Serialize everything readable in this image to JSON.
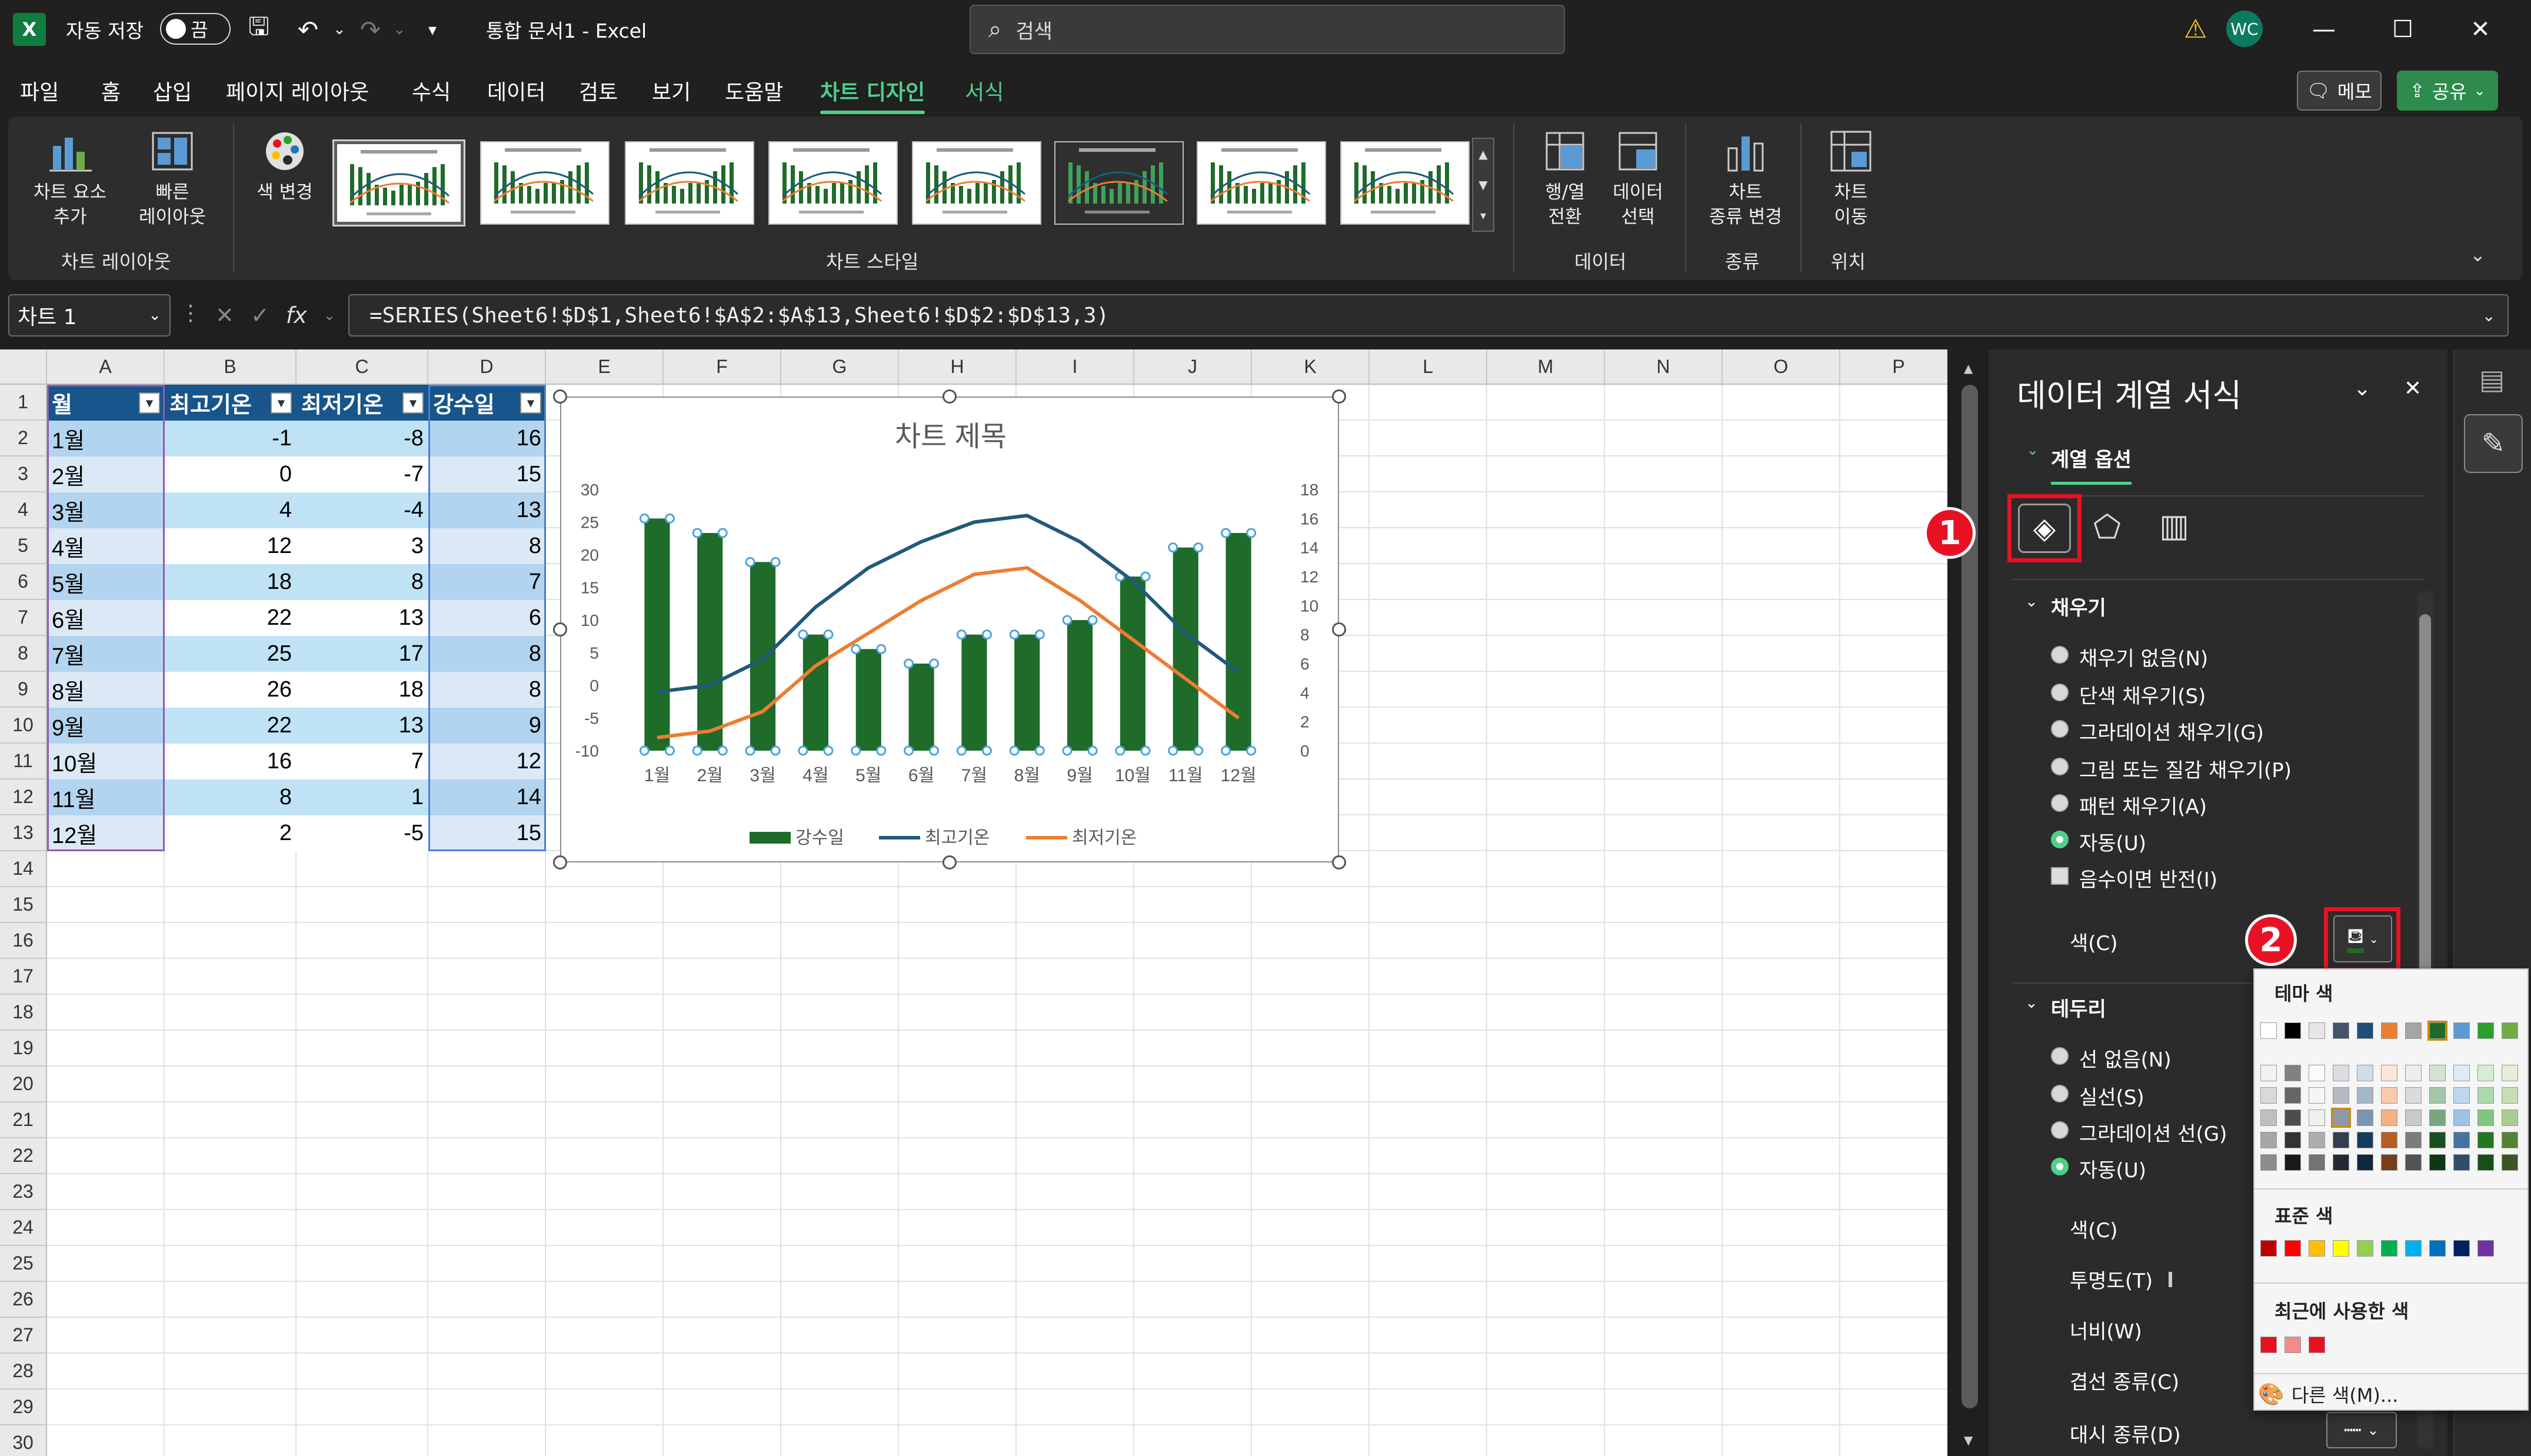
{
  "titlebar": {
    "autosave_label": "자동 저장",
    "autosave_state": "끔",
    "document_title": "통합 문서1  -  Excel",
    "search_placeholder": "검색",
    "user_initials": "WC",
    "app_logo": "X"
  },
  "ribbon_tabs": [
    "파일",
    "홈",
    "삽입",
    "페이지 레이아웃",
    "수식",
    "데이터",
    "검토",
    "보기",
    "도움말",
    "차트 디자인",
    "서식"
  ],
  "active_tab": "차트 디자인",
  "top_buttons": {
    "memo": "메모",
    "share": "공유"
  },
  "ribbon": {
    "add_element": [
      "차트 요소",
      "추가"
    ],
    "quick_layout": [
      "빠른",
      "레이아웃"
    ],
    "change_color": "색 변경",
    "switch_rowcol": [
      "행/열",
      "전환"
    ],
    "select_data": [
      "데이터",
      "선택"
    ],
    "change_type": [
      "차트",
      "종류 변경"
    ],
    "move_chart": [
      "차트",
      "이동"
    ],
    "groups": {
      "layout": "차트 레이아웃",
      "styles": "차트 스타일",
      "data": "데이터",
      "type": "종류",
      "location": "위치"
    }
  },
  "formula_bar": {
    "name_box": "차트 1",
    "fx": "fx",
    "formula": "=SERIES(Sheet6!$D$1,Sheet6!$A$2:$A$13,Sheet6!$D$2:$D$13,3)"
  },
  "grid": {
    "columns": [
      "A",
      "B",
      "C",
      "D",
      "E",
      "F",
      "G",
      "H",
      "I",
      "J",
      "K",
      "L",
      "M",
      "N",
      "O",
      "P"
    ],
    "rows": [
      "1",
      "2",
      "3",
      "4",
      "5",
      "6",
      "7",
      "8",
      "9",
      "10",
      "11",
      "12",
      "13",
      "14",
      "15",
      "16",
      "17",
      "18",
      "19",
      "20",
      "21",
      "22",
      "23",
      "24",
      "25",
      "26",
      "27",
      "28",
      "29",
      "30"
    ]
  },
  "table": {
    "headers": [
      "월",
      "최고기온",
      "최저기온",
      "강수일"
    ],
    "rows": [
      [
        "1월",
        "-1",
        "-8",
        "16"
      ],
      [
        "2월",
        "0",
        "-7",
        "15"
      ],
      [
        "3월",
        "4",
        "-4",
        "13"
      ],
      [
        "4월",
        "12",
        "3",
        "8"
      ],
      [
        "5월",
        "18",
        "8",
        "7"
      ],
      [
        "6월",
        "22",
        "13",
        "6"
      ],
      [
        "7월",
        "25",
        "17",
        "8"
      ],
      [
        "8월",
        "26",
        "18",
        "8"
      ],
      [
        "9월",
        "22",
        "13",
        "9"
      ],
      [
        "10월",
        "16",
        "7",
        "12"
      ],
      [
        "11월",
        "8",
        "1",
        "14"
      ],
      [
        "12월",
        "2",
        "-5",
        "15"
      ]
    ]
  },
  "chart_data": {
    "type": "bar",
    "title": "차트 제목",
    "categories": [
      "1월",
      "2월",
      "3월",
      "4월",
      "5월",
      "6월",
      "7월",
      "8월",
      "9월",
      "10월",
      "11월",
      "12월"
    ],
    "series": [
      {
        "name": "강수일",
        "type": "bar",
        "axis": "secondary",
        "values": [
          16,
          15,
          13,
          8,
          7,
          6,
          8,
          8,
          9,
          12,
          14,
          15
        ],
        "color": "#1e6b2a"
      },
      {
        "name": "최고기온",
        "type": "line",
        "axis": "primary",
        "values": [
          -1,
          0,
          4,
          12,
          18,
          22,
          25,
          26,
          22,
          16,
          8,
          2
        ],
        "color": "#1f5a7a"
      },
      {
        "name": "최저기온",
        "type": "line",
        "axis": "primary",
        "values": [
          -8,
          -7,
          -4,
          3,
          8,
          13,
          17,
          18,
          13,
          7,
          1,
          -5
        ],
        "color": "#ed7d31"
      }
    ],
    "y_primary": {
      "min": -10,
      "max": 30,
      "step": 5,
      "ticks": [
        "30",
        "25",
        "20",
        "15",
        "10",
        "5",
        "0",
        "-5",
        "-10"
      ]
    },
    "y_secondary": {
      "min": 0,
      "max": 18,
      "step": 2,
      "ticks": [
        "18",
        "16",
        "14",
        "12",
        "10",
        "8",
        "6",
        "4",
        "2",
        "0"
      ]
    },
    "legend": "bottom",
    "grid": false
  },
  "pane": {
    "title": "데이터 계열 서식",
    "subtitle": "계열 옵션",
    "fill_section": "채우기",
    "fill_options": [
      "채우기 없음(N)",
      "단색 채우기(S)",
      "그라데이션 채우기(G)",
      "그림 또는 질감 채우기(P)",
      "패턴 채우기(A)",
      "자동(U)"
    ],
    "fill_selected": "자동(U)",
    "invert_label": "음수이면 반전(I)",
    "color_label": "색(C)",
    "border_section": "테두리",
    "border_options": [
      "선 없음(N)",
      "실선(S)",
      "그라데이션 선(G)",
      "자동(U)"
    ],
    "border_selected": "자동(U)",
    "border_color": "색(C)",
    "transparency": "투명도(T)",
    "width": "너비(W)",
    "compound": "겹선 종류(C)",
    "dash": "대시 종류(D)"
  },
  "color_popup": {
    "theme_label": "테마 색",
    "standard_label": "표준 색",
    "recent_label": "최근에 사용한 색",
    "more_colors": "다른 색(M)...",
    "theme_top": [
      "#ffffff",
      "#000000",
      "#e7e6e6",
      "#44546a",
      "#1f4e79",
      "#ed7d31",
      "#a5a5a5",
      "#1e6b2a",
      "#5b9bd5",
      "#2ca02c",
      "#70ad47"
    ],
    "standard": [
      "#c00000",
      "#ff0000",
      "#ffc000",
      "#ffff00",
      "#92d050",
      "#00b050",
      "#00b0f0",
      "#0070c0",
      "#002060",
      "#7030a0"
    ],
    "recent": [
      "#e81123",
      "#f28b8b",
      "#e81123"
    ]
  },
  "annotations": [
    "1",
    "2"
  ]
}
